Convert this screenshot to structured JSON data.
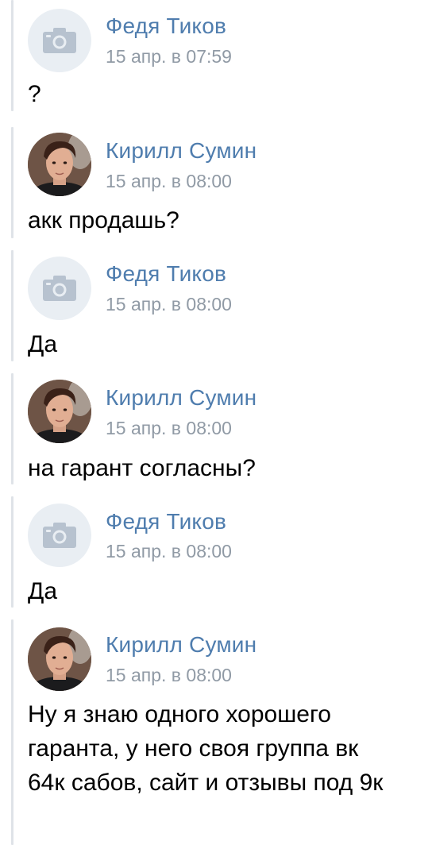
{
  "messages": [
    {
      "author": "Федя Тиков",
      "time": "15 апр. в 07:59",
      "text": "?",
      "avatar": "camera-placeholder"
    },
    {
      "author": "Кирилл Сумин",
      "time": "15 апр. в 08:00",
      "text": "акк продашь?",
      "avatar": "user-photo"
    },
    {
      "author": "Федя Тиков",
      "time": "15 апр. в 08:00",
      "text": "Да",
      "avatar": "camera-placeholder"
    },
    {
      "author": "Кирилл Сумин",
      "time": "15 апр. в 08:00",
      "text": "на гарант согласны?",
      "avatar": "user-photo"
    },
    {
      "author": "Федя Тиков",
      "time": "15 апр. в 08:00",
      "text": "Да",
      "avatar": "camera-placeholder"
    },
    {
      "author": "Кирилл Сумин",
      "time": "15 апр. в 08:00",
      "text": "Ну я знаю одного хорошего гаранта, у него своя группа вк 64к сабов, сайт и отзывы под 9к",
      "avatar": "user-photo"
    }
  ],
  "colors": {
    "author": "#4f7dae",
    "time": "#909aa5",
    "text": "#000000",
    "quote_line": "#dfe3e8",
    "placeholder_bg": "#e9eef3",
    "camera_icon": "#b7c2cf"
  }
}
